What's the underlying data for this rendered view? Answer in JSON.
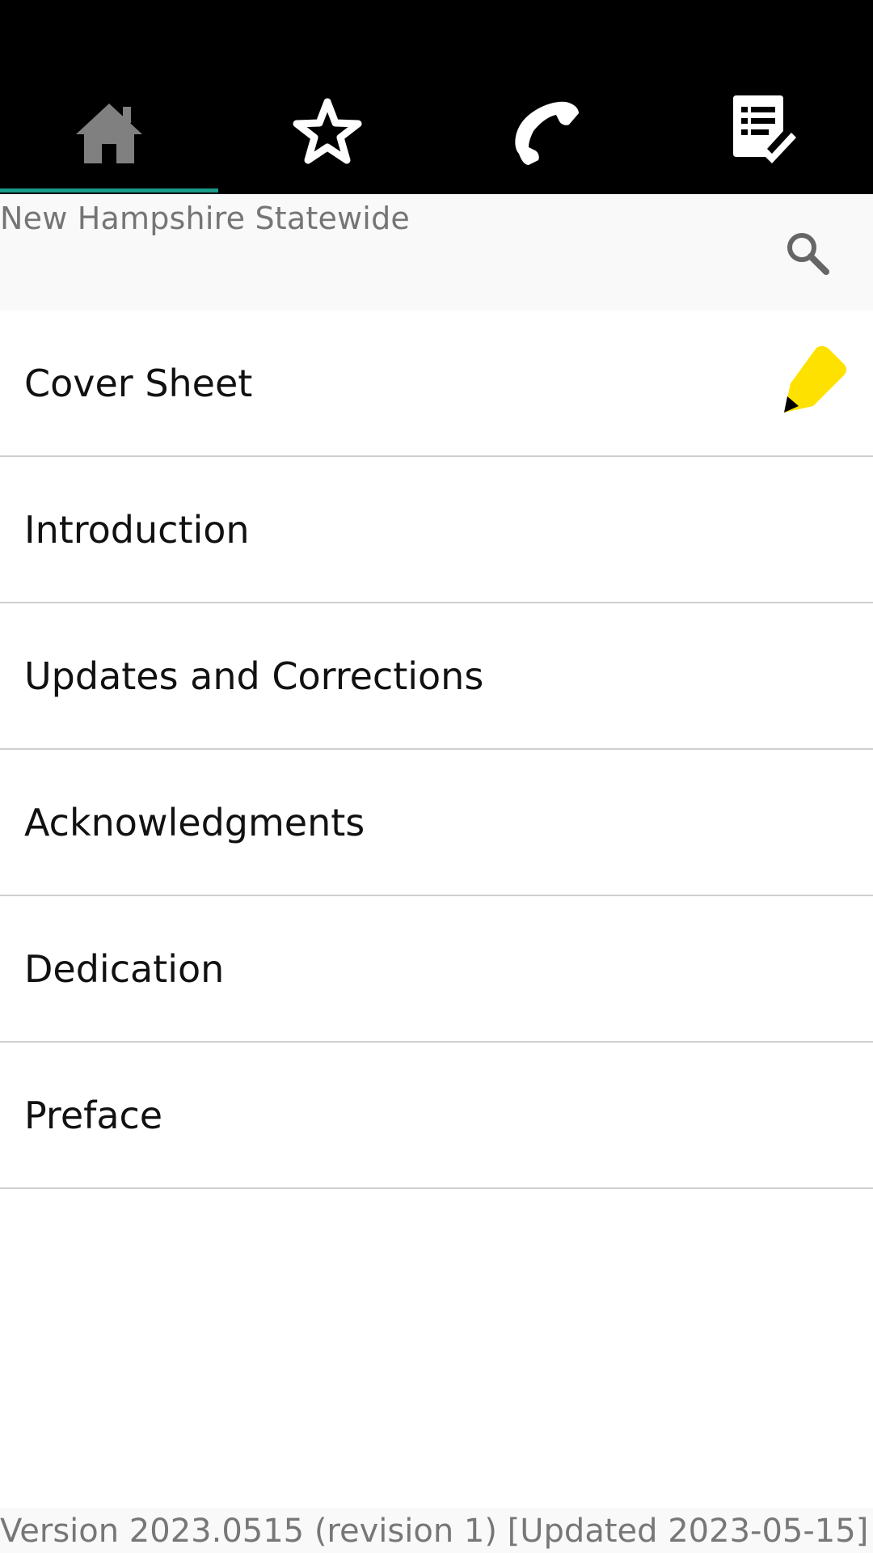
{
  "tabs": [
    {
      "icon": "home-icon",
      "selected": true
    },
    {
      "icon": "star-icon",
      "selected": false
    },
    {
      "icon": "phone-icon",
      "selected": false
    },
    {
      "icon": "checklist-icon",
      "selected": false
    }
  ],
  "colors": {
    "tabbar_bg": "#000000",
    "tab_indicator": "#1a9a8a",
    "selected_icon": "#808080",
    "icon": "#ffffff",
    "note_icon": "#ffe100"
  },
  "header": {
    "title": "New Hampshire Statewide",
    "search_icon": "search-icon"
  },
  "list": {
    "items": [
      {
        "label": "Cover Sheet",
        "icon": "note-pencil-icon"
      },
      {
        "label": "Introduction"
      },
      {
        "label": "Updates and Corrections"
      },
      {
        "label": "Acknowledgments"
      },
      {
        "label": "Dedication"
      },
      {
        "label": "Preface"
      }
    ]
  },
  "footer": {
    "version_text": "Version 2023.0515 (revision 1) [Updated 2023-05-15]"
  }
}
